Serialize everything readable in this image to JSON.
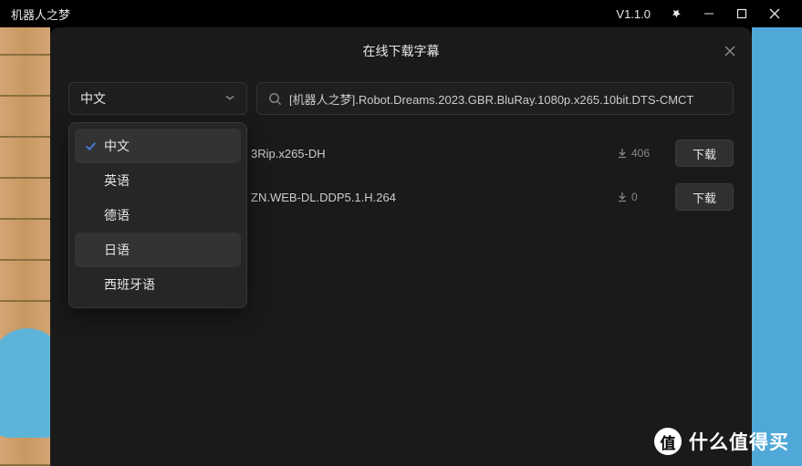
{
  "titlebar": {
    "title": "机器人之梦",
    "version": "V1.1.0"
  },
  "modal": {
    "title": "在线下载字幕"
  },
  "select": {
    "current": "中文",
    "options": [
      "中文",
      "英语",
      "德语",
      "日语",
      "西班牙语"
    ],
    "selectedIndex": 0,
    "hoverIndex": 3
  },
  "search": {
    "value": "[机器人之梦].Robot.Dreams.2023.GBR.BluRay.1080p.x265.10bit.DTS-CMCT"
  },
  "results": [
    {
      "name": "3Rip.x265-DH",
      "count": "406",
      "button": "下载"
    },
    {
      "name": "ZN.WEB-DL.DDP5.1.H.264",
      "count": "0",
      "button": "下载"
    }
  ],
  "watermark": {
    "badge": "值",
    "text": "什么值得买"
  }
}
